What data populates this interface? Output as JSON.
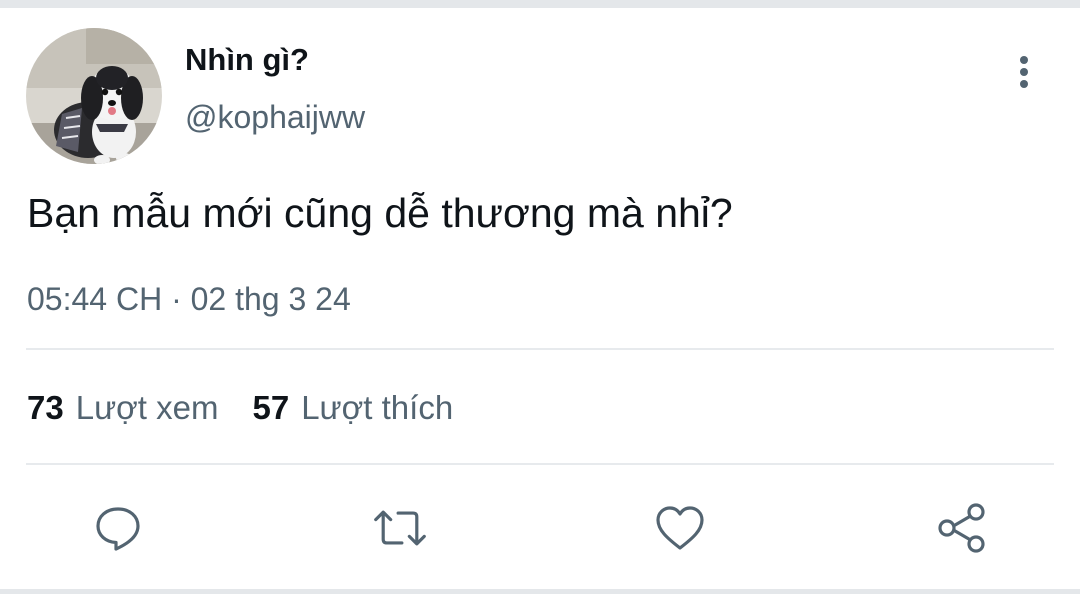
{
  "tweet": {
    "display_name": "Nhìn gì?",
    "handle": "@kophaijww",
    "text": "Bạn mẫu mới cũng dễ thương mà nhỉ?",
    "timestamp": "05:44 CH · 02 thg 3 24"
  },
  "stats": {
    "views_count": "73",
    "views_label": "Lượt xem",
    "likes_count": "57",
    "likes_label": "Lượt thích"
  },
  "actions": [
    {
      "name": "reply",
      "icon": "speech-bubble-icon"
    },
    {
      "name": "retweet",
      "icon": "retweet-arrows-icon"
    },
    {
      "name": "like",
      "icon": "heart-icon"
    },
    {
      "name": "share",
      "icon": "share-nodes-icon"
    }
  ],
  "colors": {
    "primary_text": "#0f1419",
    "secondary_text": "#536471",
    "divider": "#e7eaed"
  }
}
